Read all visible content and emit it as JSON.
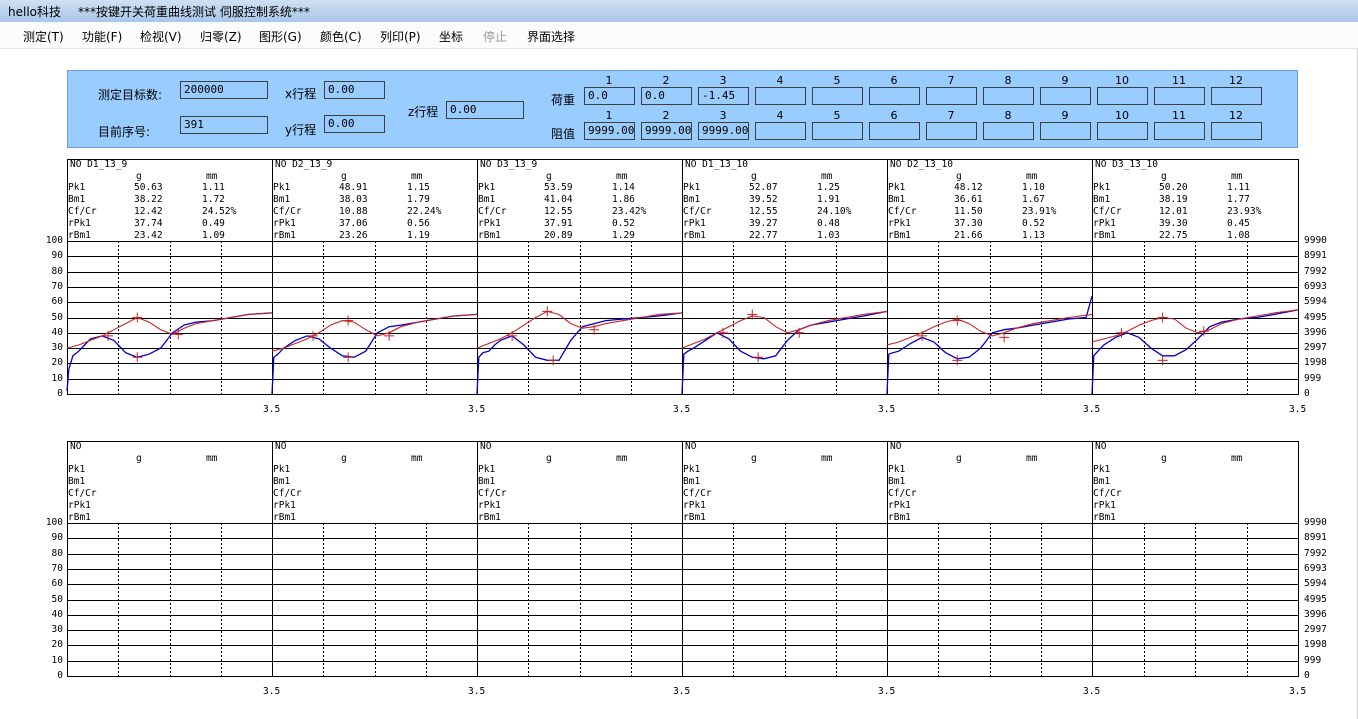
{
  "window": {
    "app": "hello科技",
    "title": "***按键开关荷重曲线测试 伺服控制系统***"
  },
  "menu": [
    {
      "label": "测定(T)",
      "enabled": true
    },
    {
      "label": "功能(F)",
      "enabled": true
    },
    {
      "label": "检视(V)",
      "enabled": true
    },
    {
      "label": "归零(Z)",
      "enabled": true
    },
    {
      "label": "图形(G)",
      "enabled": true
    },
    {
      "label": "颜色(C)",
      "enabled": true
    },
    {
      "label": "列印(P)",
      "enabled": true
    },
    {
      "label": "坐标",
      "enabled": true
    },
    {
      "label": "停止",
      "enabled": false
    },
    {
      "label": "界面选择",
      "enabled": true
    }
  ],
  "panel": {
    "target_label": "测定目标数:",
    "target_value": "200000",
    "seq_label": "目前序号:",
    "seq_value": "391",
    "x_label": "x行程",
    "x_value": "0.00",
    "y_label": "y行程",
    "y_value": "0.00",
    "z_label": "z行程",
    "z_value": "0.00",
    "load_label": "荷重",
    "res_label": "阻值",
    "channels": [
      "1",
      "2",
      "3",
      "4",
      "5",
      "6",
      "7",
      "8",
      "9",
      "10",
      "11",
      "12"
    ],
    "load_values": [
      "0.0",
      "0.0",
      "-1.45",
      "",
      "",
      "",
      "",
      "",
      "",
      "",
      "",
      ""
    ],
    "res_values": [
      "9999.00",
      "9999.00",
      "9999.00",
      "",
      "",
      "",
      "",
      "",
      "",
      "",
      "",
      ""
    ]
  },
  "axis": {
    "left_ticks": [
      "100",
      "90",
      "80",
      "70",
      "60",
      "50",
      "40",
      "30",
      "20",
      "10",
      "0"
    ],
    "right_ticks": [
      "9990",
      "8991",
      "7992",
      "6993",
      "5994",
      "4995",
      "3996",
      "2997",
      "1998",
      "999",
      "0"
    ],
    "x_end_label": "3.5"
  },
  "colors": {
    "load_curve": "#0000cc",
    "res_curve": "#cc2222",
    "marker": "#cc2222",
    "panel": "#99ccff"
  },
  "rows": [
    {
      "cells": [
        {
          "no": "NO  D1_13_9",
          "unit_g": "g",
          "unit_mm": "mm",
          "stats": [
            [
              "Pk1",
              "50.63",
              "1.11"
            ],
            [
              "Bm1",
              "38.22",
              "1.72"
            ],
            [
              "Cf/Cr",
              "12.42",
              "24.52%"
            ],
            [
              "rPk1",
              "37.74",
              "0.49"
            ],
            [
              "rBm1",
              "23.42",
              "1.09"
            ]
          ],
          "load_x": [
            0,
            0.03,
            0.1,
            0.2,
            0.3,
            0.4,
            0.5,
            0.6,
            0.8,
            1.0,
            1.2,
            1.4,
            1.6,
            1.8,
            2.0,
            2.2,
            2.5,
            2.8,
            3.1,
            3.5
          ],
          "load_y": [
            2,
            16,
            25,
            28,
            32,
            36,
            37,
            38,
            35,
            27,
            24,
            26,
            30,
            40,
            45,
            47,
            48,
            50,
            52,
            53
          ],
          "res_x": [
            0,
            0.2,
            0.4,
            0.6,
            0.8,
            1.0,
            1.2,
            1.4,
            1.6,
            1.8,
            2.0,
            2.2,
            2.5,
            2.8,
            3.1,
            3.5
          ],
          "res_y": [
            30,
            32,
            35,
            38,
            42,
            46,
            50,
            47,
            42,
            39,
            43,
            46,
            48,
            50,
            52,
            53
          ],
          "markers": [
            [
              0.7,
              38
            ],
            [
              1.2,
              50
            ],
            [
              1.2,
              24
            ],
            [
              1.9,
              39
            ]
          ]
        },
        {
          "no": "NO  D2_13_9",
          "unit_g": "g",
          "unit_mm": "mm",
          "stats": [
            [
              "Pk1",
              "48.91",
              "1.15"
            ],
            [
              "Bm1",
              "38.03",
              "1.79"
            ],
            [
              "Cf/Cr",
              "10.88",
              "22.24%"
            ],
            [
              "rPk1",
              "37.06",
              "0.56"
            ],
            [
              "rBm1",
              "23.26",
              "1.19"
            ]
          ],
          "load_x": [
            0,
            0.03,
            0.1,
            0.2,
            0.4,
            0.6,
            0.8,
            1.0,
            1.2,
            1.4,
            1.6,
            1.8,
            2.0,
            2.2,
            2.5,
            2.8,
            3.1,
            3.5
          ],
          "load_y": [
            0,
            24,
            26,
            30,
            35,
            38,
            36,
            30,
            25,
            24,
            28,
            40,
            44,
            45,
            47,
            49,
            51,
            52
          ],
          "res_x": [
            0,
            0.2,
            0.4,
            0.6,
            0.8,
            1.0,
            1.2,
            1.4,
            1.6,
            1.8,
            2.0,
            2.2,
            2.5,
            2.8,
            3.1,
            3.5
          ],
          "res_y": [
            28,
            30,
            33,
            36,
            40,
            45,
            48,
            47,
            42,
            38,
            40,
            44,
            47,
            49,
            51,
            52
          ],
          "markers": [
            [
              0.7,
              38
            ],
            [
              1.3,
              48
            ],
            [
              1.3,
              24
            ],
            [
              2.0,
              38
            ]
          ]
        },
        {
          "no": "NO  D3_13_9",
          "unit_g": "g",
          "unit_mm": "mm",
          "stats": [
            [
              "Pk1",
              "53.59",
              "1.14"
            ],
            [
              "Bm1",
              "41.04",
              "1.86"
            ],
            [
              "Cf/Cr",
              "12.55",
              "23.42%"
            ],
            [
              "rPk1",
              "37.91",
              "0.52"
            ],
            [
              "rBm1",
              "20.89",
              "1.29"
            ]
          ],
          "load_x": [
            0,
            0.03,
            0.1,
            0.2,
            0.3,
            0.4,
            0.6,
            0.8,
            1.0,
            1.2,
            1.4,
            1.6,
            1.8,
            2.0,
            2.2,
            2.5,
            2.8,
            3.1,
            3.5
          ],
          "load_y": [
            0,
            24,
            27,
            28,
            32,
            35,
            38,
            32,
            24,
            22,
            22,
            35,
            44,
            46,
            48,
            49,
            50,
            51,
            53
          ],
          "res_x": [
            0,
            0.2,
            0.4,
            0.6,
            0.8,
            1.0,
            1.2,
            1.4,
            1.6,
            1.8,
            2.0,
            2.2,
            2.5,
            2.8,
            3.1,
            3.5
          ],
          "res_y": [
            30,
            33,
            36,
            40,
            45,
            50,
            54,
            52,
            46,
            43,
            44,
            46,
            48,
            50,
            52,
            53
          ],
          "markers": [
            [
              0.6,
              38
            ],
            [
              1.2,
              54
            ],
            [
              1.3,
              22
            ],
            [
              2.0,
              42
            ]
          ]
        }
      ]
    },
    {
      "cells": [
        {
          "no": "NO  D1_13_10",
          "unit_g": "g",
          "unit_mm": "mm",
          "stats": [
            [
              "Pk1",
              "52.07",
              "1.25"
            ],
            [
              "Bm1",
              "39.52",
              "1.91"
            ],
            [
              "Cf/Cr",
              "12.55",
              "24.10%"
            ],
            [
              "rPk1",
              "39.27",
              "0.48"
            ],
            [
              "rBm1",
              "22.77",
              "1.03"
            ]
          ],
          "load_x": [
            0,
            0.03,
            0.1,
            0.2,
            0.4,
            0.6,
            0.8,
            1.0,
            1.2,
            1.4,
            1.6,
            1.8,
            2.0,
            2.2,
            2.5,
            2.8,
            3.1,
            3.5
          ],
          "load_y": [
            0,
            26,
            28,
            30,
            35,
            40,
            36,
            28,
            24,
            23,
            25,
            35,
            42,
            45,
            47,
            49,
            51,
            54
          ],
          "res_x": [
            0,
            0.2,
            0.4,
            0.6,
            0.8,
            1.0,
            1.2,
            1.4,
            1.6,
            1.8,
            2.0,
            2.2,
            2.5,
            2.8,
            3.1,
            3.5
          ],
          "res_y": [
            30,
            33,
            36,
            40,
            44,
            48,
            51,
            50,
            44,
            40,
            42,
            45,
            48,
            50,
            52,
            54
          ],
          "markers": [
            [
              0.7,
              40
            ],
            [
              1.2,
              52
            ],
            [
              1.3,
              24
            ],
            [
              2.0,
              40
            ]
          ]
        },
        {
          "no": "NO  D2_13_10",
          "unit_g": "g",
          "unit_mm": "mm",
          "stats": [
            [
              "Pk1",
              "48.12",
              "1.10"
            ],
            [
              "Bm1",
              "36.61",
              "1.67"
            ],
            [
              "Cf/Cr",
              "11.50",
              "23.91%"
            ],
            [
              "rPk1",
              "37.30",
              "0.52"
            ],
            [
              "rBm1",
              "21.66",
              "1.13"
            ]
          ],
          "load_x": [
            0,
            0.03,
            0.1,
            0.2,
            0.4,
            0.6,
            0.8,
            1.0,
            1.2,
            1.4,
            1.6,
            1.8,
            2.0,
            2.2,
            2.5,
            2.8,
            3.1,
            3.4,
            3.5
          ],
          "load_y": [
            0,
            26,
            27,
            28,
            33,
            37,
            34,
            27,
            23,
            24,
            30,
            40,
            42,
            43,
            45,
            47,
            49,
            50,
            64
          ],
          "res_x": [
            0,
            0.2,
            0.4,
            0.6,
            0.8,
            1.0,
            1.2,
            1.4,
            1.6,
            1.8,
            2.0,
            2.2,
            2.5,
            2.8,
            3.1,
            3.5
          ],
          "res_y": [
            32,
            34,
            37,
            40,
            44,
            47,
            49,
            46,
            41,
            38,
            40,
            43,
            46,
            48,
            50,
            52
          ],
          "markers": [
            [
              0.6,
              38
            ],
            [
              1.2,
              48
            ],
            [
              1.2,
              22
            ],
            [
              2.0,
              37
            ]
          ]
        },
        {
          "no": "NO  D3_13_10",
          "unit_g": "g",
          "unit_mm": "mm",
          "stats": [
            [
              "Pk1",
              "50.20",
              "1.11"
            ],
            [
              "Bm1",
              "38.19",
              "1.77"
            ],
            [
              "Cf/Cr",
              "12.01",
              "23.93%"
            ],
            [
              "rPk1",
              "39.30",
              "0.45"
            ],
            [
              "rBm1",
              "22.75",
              "1.08"
            ]
          ],
          "load_x": [
            0,
            0.03,
            0.1,
            0.2,
            0.4,
            0.6,
            0.8,
            1.0,
            1.2,
            1.4,
            1.6,
            1.8,
            2.0,
            2.2,
            2.5,
            2.8,
            3.1,
            3.5
          ],
          "load_y": [
            0,
            25,
            28,
            32,
            37,
            40,
            37,
            30,
            25,
            25,
            29,
            36,
            44,
            47,
            49,
            50,
            52,
            55
          ],
          "res_x": [
            0,
            0.2,
            0.4,
            0.6,
            0.8,
            1.0,
            1.2,
            1.4,
            1.6,
            1.8,
            2.0,
            2.2,
            2.5,
            2.8,
            3.1,
            3.5
          ],
          "res_y": [
            34,
            36,
            38,
            41,
            45,
            48,
            50,
            49,
            43,
            40,
            42,
            46,
            49,
            51,
            53,
            55
          ],
          "markers": [
            [
              0.5,
              40
            ],
            [
              1.2,
              50
            ],
            [
              1.2,
              22
            ],
            [
              1.9,
              41
            ]
          ]
        }
      ]
    },
    {
      "cells": [
        {
          "no": "NO",
          "unit_g": "g",
          "unit_mm": "mm",
          "stats": [
            [
              "Pk1",
              "",
              ""
            ],
            [
              "Bm1",
              "",
              ""
            ],
            [
              "Cf/Cr",
              "",
              ""
            ],
            [
              "rPk1",
              "",
              ""
            ],
            [
              "rBm1",
              "",
              ""
            ]
          ],
          "load_x": [],
          "load_y": [],
          "res_x": [],
          "res_y": [],
          "markers": []
        },
        {
          "no": "NO",
          "unit_g": "g",
          "unit_mm": "mm",
          "stats": [
            [
              "Pk1",
              "",
              ""
            ],
            [
              "Bm1",
              "",
              ""
            ],
            [
              "Cf/Cr",
              "",
              ""
            ],
            [
              "rPk1",
              "",
              ""
            ],
            [
              "rBm1",
              "",
              ""
            ]
          ],
          "load_x": [],
          "load_y": [],
          "res_x": [],
          "res_y": [],
          "markers": []
        },
        {
          "no": "NO",
          "unit_g": "g",
          "unit_mm": "mm",
          "stats": [
            [
              "Pk1",
              "",
              ""
            ],
            [
              "Bm1",
              "",
              ""
            ],
            [
              "Cf/Cr",
              "",
              ""
            ],
            [
              "rPk1",
              "",
              ""
            ],
            [
              "rBm1",
              "",
              ""
            ]
          ],
          "load_x": [],
          "load_y": [],
          "res_x": [],
          "res_y": [],
          "markers": []
        },
        {
          "no": "NO",
          "unit_g": "g",
          "unit_mm": "mm",
          "stats": [
            [
              "Pk1",
              "",
              ""
            ],
            [
              "Bm1",
              "",
              ""
            ],
            [
              "Cf/Cr",
              "",
              ""
            ],
            [
              "rPk1",
              "",
              ""
            ],
            [
              "rBm1",
              "",
              ""
            ]
          ],
          "load_x": [],
          "load_y": [],
          "res_x": [],
          "res_y": [],
          "markers": []
        },
        {
          "no": "NO",
          "unit_g": "g",
          "unit_mm": "mm",
          "stats": [
            [
              "Pk1",
              "",
              ""
            ],
            [
              "Bm1",
              "",
              ""
            ],
            [
              "Cf/Cr",
              "",
              ""
            ],
            [
              "rPk1",
              "",
              ""
            ],
            [
              "rBm1",
              "",
              ""
            ]
          ],
          "load_x": [],
          "load_y": [],
          "res_x": [],
          "res_y": [],
          "markers": []
        },
        {
          "no": "NO",
          "unit_g": "g",
          "unit_mm": "mm",
          "stats": [
            [
              "Pk1",
              "",
              ""
            ],
            [
              "Bm1",
              "",
              ""
            ],
            [
              "Cf/Cr",
              "",
              ""
            ],
            [
              "rPk1",
              "",
              ""
            ],
            [
              "rBm1",
              "",
              ""
            ]
          ],
          "load_x": [],
          "load_y": [],
          "res_x": [],
          "res_y": [],
          "markers": []
        }
      ]
    }
  ]
}
